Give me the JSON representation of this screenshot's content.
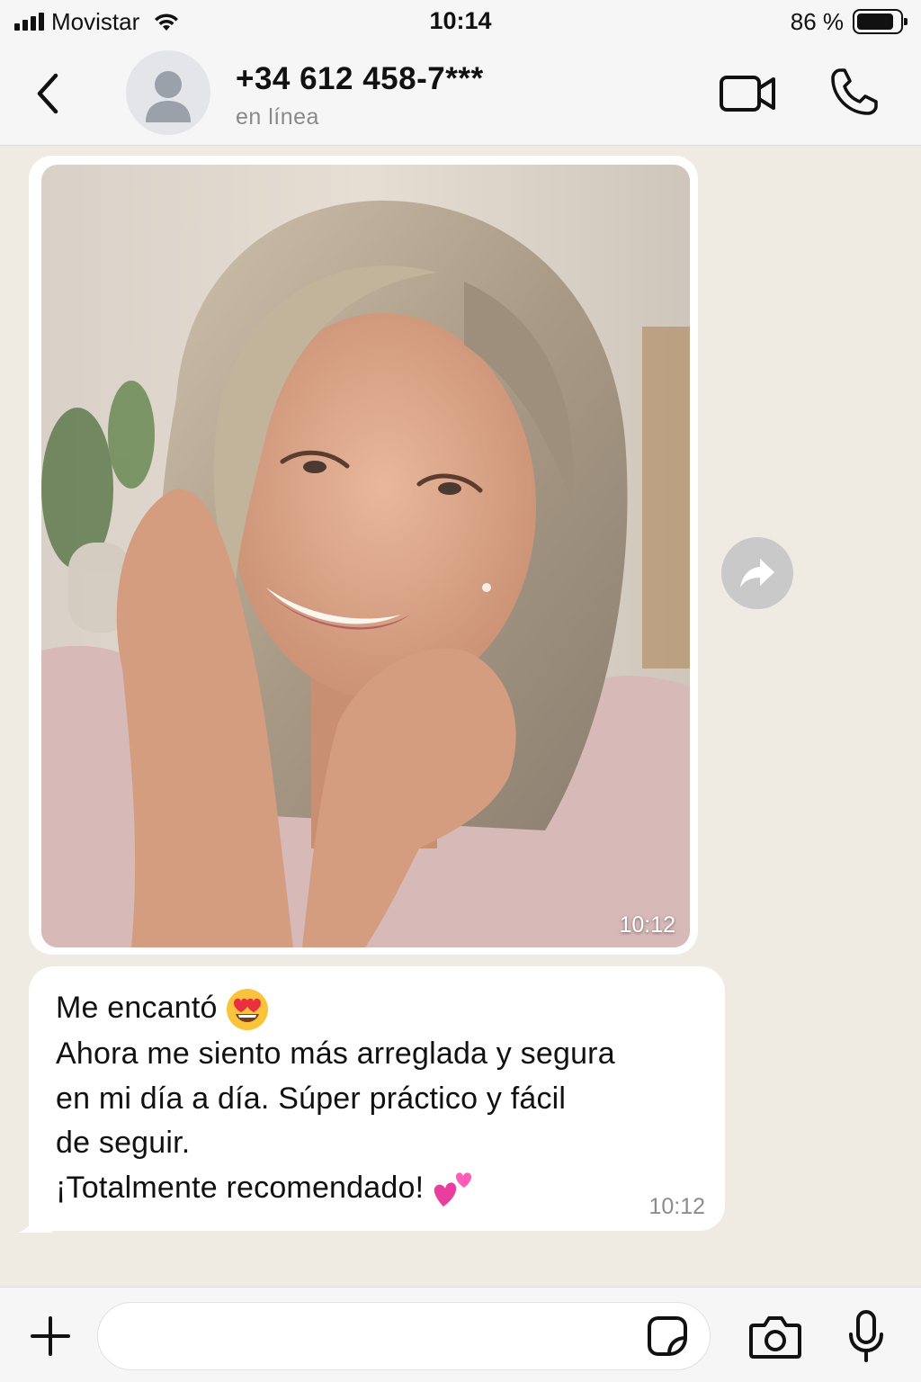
{
  "status_bar": {
    "carrier": "Movistar",
    "time": "10:14",
    "battery_percent": "86 %",
    "battery_level": 0.86,
    "signal_bars": 4
  },
  "header": {
    "contact_name": "+34 612 458-7***",
    "contact_status": "en línea",
    "icons": [
      "back-icon",
      "avatar-placeholder-icon",
      "video-call-icon",
      "phone-icon"
    ]
  },
  "messages": [
    {
      "type": "image",
      "time": "10:12"
    },
    {
      "type": "text",
      "lines": [
        "Me encantó",
        "Ahora me siento más arreglada y segura",
        "en mi día a día. Súper práctico y fácil",
        "de seguir.",
        "¡Totalmente recomendado!"
      ],
      "emojis": [
        "heart-eyes-emoji",
        "two-hearts-emoji"
      ],
      "time": "10:12"
    }
  ],
  "input_bar": {
    "placeholder": "",
    "icons": [
      "plus-icon",
      "sticker-icon",
      "camera-icon",
      "microphone-icon"
    ]
  },
  "colors": {
    "chat_background": "#efebe3",
    "bubble": "#ffffff",
    "bars": "#f6f6f6",
    "meta_text": "#8c8c8c"
  }
}
